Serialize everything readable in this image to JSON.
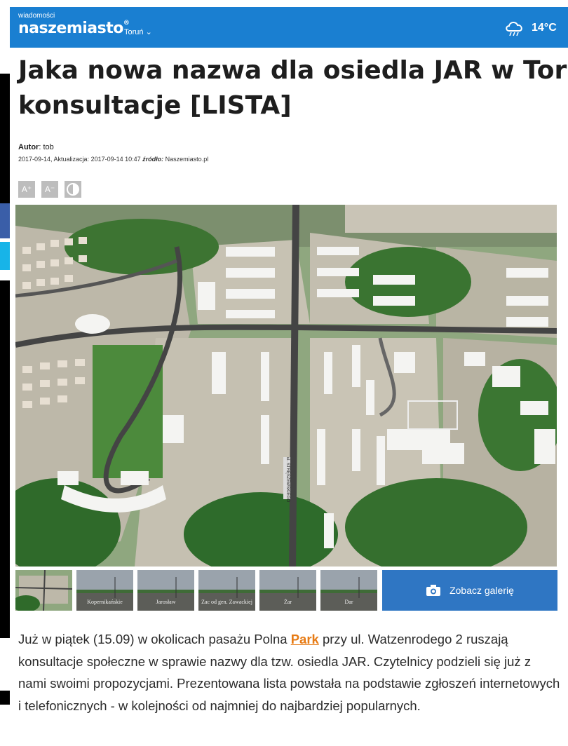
{
  "header": {
    "brand_small": "wiadomości",
    "brand": "naszemiasto",
    "brand_mark": "®",
    "city": "Toruń",
    "city_caret": "⌄",
    "weather_icon": "rain-cloud-icon",
    "temperature": "14°C",
    "colors": {
      "bar": "#1a7fd1"
    }
  },
  "article": {
    "title_line1": "Jaka nowa nazwa dla osiedla JAR w Tor",
    "title_line2": "konsultacje [LISTA]",
    "author_label": "Autor",
    "author": "tob",
    "date_line": "2017-09-14, Aktualizacja: 2017-09-14 10:47",
    "source_label": "źródło:",
    "source": "Naszemiasto.pl",
    "font_controls": {
      "increase": "A⁺",
      "decrease": "A⁻",
      "contrast_icon": "contrast-icon"
    },
    "hero_road_label": "ul. STRĘSZEWSKIEGO",
    "thumbnails": [
      "",
      "Kopernikańskie",
      "Jarosław",
      "Zac od gen. Zawackiej",
      "Żar",
      "Dar"
    ],
    "gallery_button": "Zobacz galerię",
    "gallery_icon": "camera-icon",
    "lead_part1": "Już w piątek (15.09) w okolicach pasażu Polna ",
    "lead_link": "Park",
    "lead_part2": " przy ul. Watzenrodego 2 ruszają konsultacje społeczne w sprawie nazwy dla tzw. osiedla JAR. Czytelnicy podzieli się już z nami swoimi propozycjami. Prezentowana lista powstała na podstawie zgłoszeń internetowych i telefonicznych - w kolejności od najmniej do najbardziej popularnych.",
    "colors": {
      "link": "#e77b15",
      "gallery_button": "#2f76c3"
    }
  }
}
